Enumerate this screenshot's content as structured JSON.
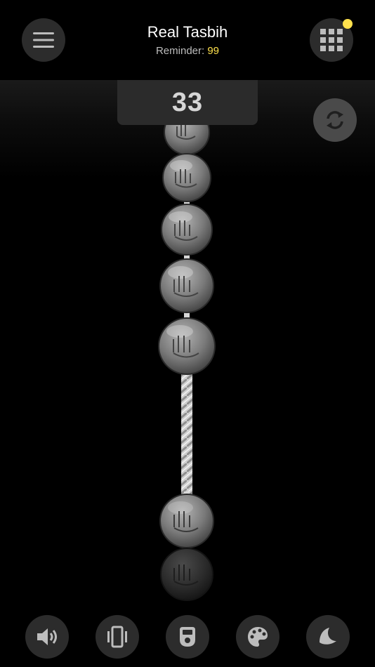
{
  "header": {
    "title": "Real Tasbih",
    "reminder_label": "Reminder:",
    "reminder_value": "99"
  },
  "counter": {
    "value": "33"
  },
  "icons": {
    "menu": "hamburger-menu-icon",
    "grid": "grid-icon",
    "reset": "refresh-icon",
    "sound": "speaker-icon",
    "vibrate": "vibration-icon",
    "counter": "counter-device-icon",
    "theme": "palette-icon",
    "night": "moon-icon"
  },
  "colors": {
    "accent": "#ffe14d",
    "button_bg": "#2c2c2c",
    "counter_bg": "#2b2b2b"
  }
}
